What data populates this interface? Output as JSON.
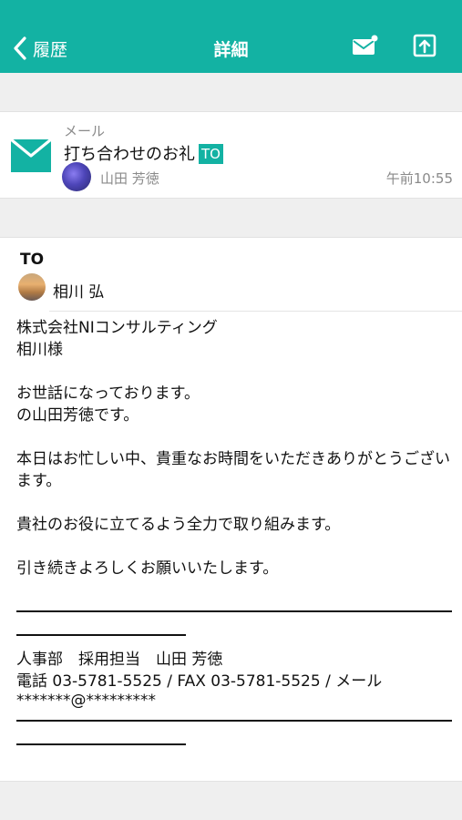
{
  "nav": {
    "back_label": "履歴",
    "title": "詳細",
    "bar_color": "#13b2a3",
    "icons": [
      "chevron-left-icon",
      "mail-icon",
      "share-icon"
    ]
  },
  "message": {
    "type_label": "メール",
    "subject": "打ち合わせのお礼",
    "to_badge": "TO",
    "sender": "山田 芳徳",
    "time": "午前10:55",
    "icon": "envelope-icon"
  },
  "recipients": {
    "label": "TO",
    "name": "相川 弘"
  },
  "body": {
    "company": "株式会社NIコンサルティング",
    "addressee": "相川様",
    "greeting1": "お世話になっております。",
    "greeting2": "の山田芳徳です。",
    "thanks": "本日はお忙しい中、貴重なお時間をいただきありがとうございます。",
    "commitment": "貴社のお役に立てるよう全力で取り組みます。",
    "closing": "引き続きよろしくお願いいたします。",
    "signature_line1": "人事部　採用担当　山田 芳徳",
    "signature_line2": "電話 03-5781-5525 / FAX 03-5781-5525 / メール",
    "signature_line3": "*******@*********"
  }
}
